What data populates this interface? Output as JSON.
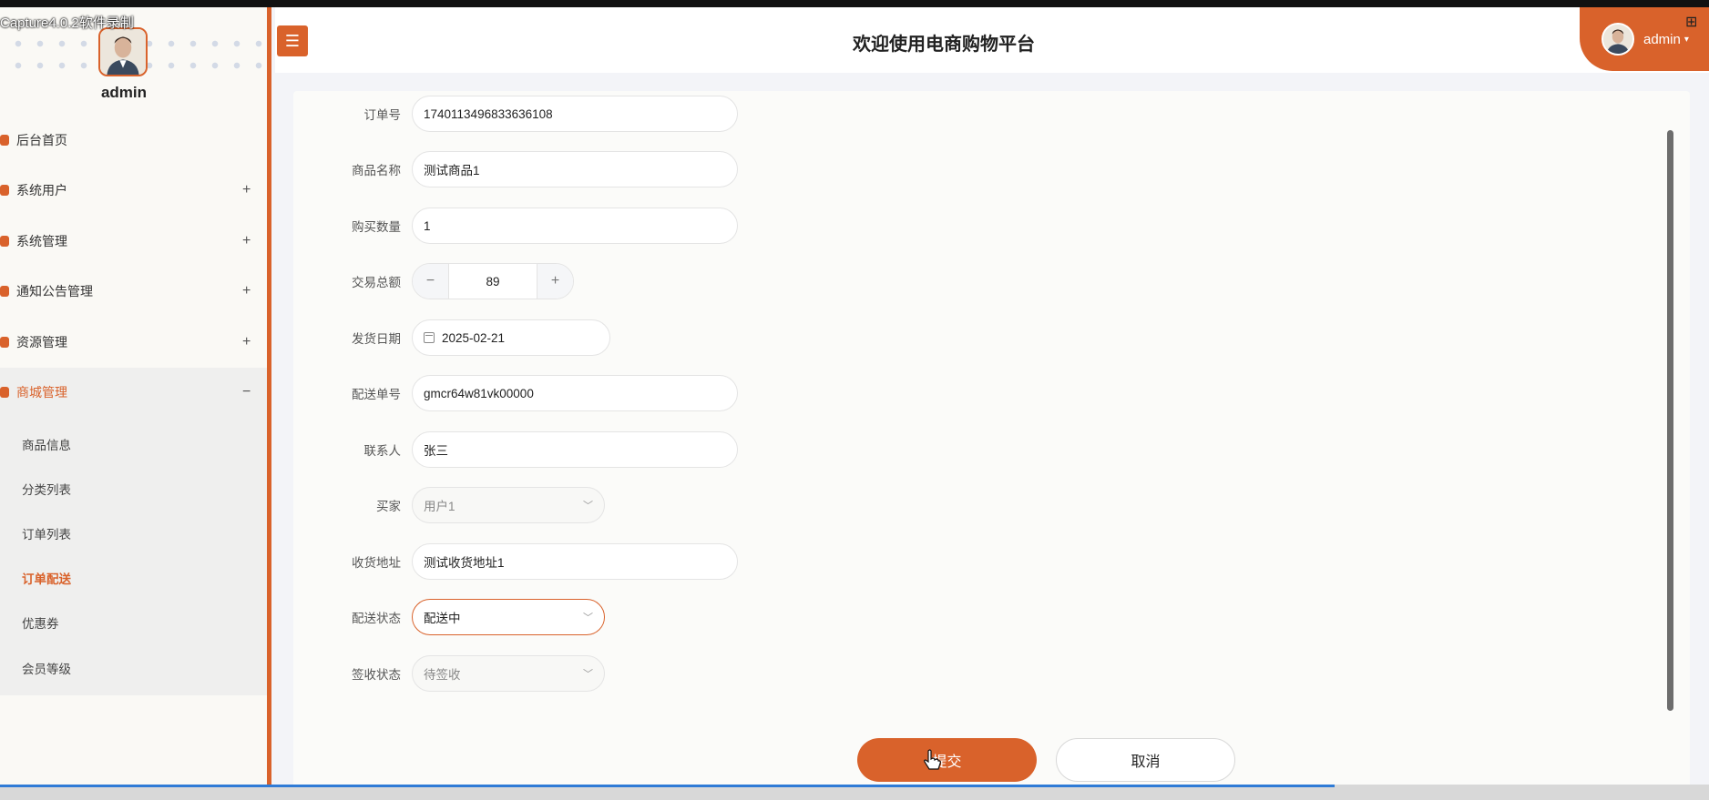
{
  "recorder": {
    "watermark": "Capture4.0.2软件录制"
  },
  "sidebar": {
    "username": "admin",
    "menu": [
      {
        "label": "后台首页",
        "toggle": ""
      },
      {
        "label": "系统用户",
        "toggle": "+"
      },
      {
        "label": "系统管理",
        "toggle": "+"
      },
      {
        "label": "通知公告管理",
        "toggle": "+"
      },
      {
        "label": "资源管理",
        "toggle": "+"
      },
      {
        "label": "商城管理",
        "toggle": "−"
      }
    ],
    "submenu": [
      {
        "label": "商品信息"
      },
      {
        "label": "分类列表"
      },
      {
        "label": "订单列表"
      },
      {
        "label": "订单配送"
      },
      {
        "label": "优惠券"
      },
      {
        "label": "会员等级"
      }
    ]
  },
  "header": {
    "title": "欢迎使用电商购物平台",
    "user": "admin",
    "menu_icon": "hamburger-icon"
  },
  "form": {
    "order_no": {
      "label": "订单号",
      "value": "1740113496833636108"
    },
    "product_name": {
      "label": "商品名称",
      "value": "测试商品1"
    },
    "quantity": {
      "label": "购买数量",
      "value": "1"
    },
    "total": {
      "label": "交易总额",
      "value": "89",
      "minus": "−",
      "plus": "+"
    },
    "ship_date": {
      "label": "发货日期",
      "value": "2025-02-21"
    },
    "tracking_no": {
      "label": "配送单号",
      "value": "gmcr64w81vk00000"
    },
    "contact": {
      "label": "联系人",
      "value": "张三"
    },
    "buyer": {
      "label": "买家",
      "value": "用户1"
    },
    "address": {
      "label": "收货地址",
      "value": "测试收货地址1"
    },
    "delivery_status": {
      "label": "配送状态",
      "value": "配送中"
    },
    "sign_status": {
      "label": "签收状态",
      "value": "待签收"
    }
  },
  "actions": {
    "submit": "提交",
    "cancel": "取消"
  },
  "colors": {
    "accent": "#d9622b"
  }
}
